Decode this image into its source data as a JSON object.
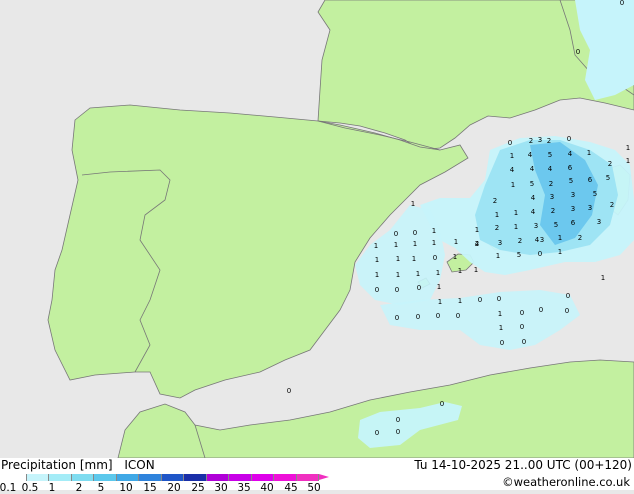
{
  "legend": {
    "title": "Precipitation [mm]",
    "model": "ICON",
    "datetime": "Tu 14-10-2025 21..00 UTC (00+120)",
    "credit": "©weatheronline.co.uk",
    "ticks": [
      "0.1",
      "0.5",
      "1",
      "2",
      "5",
      "10",
      "15",
      "20",
      "25",
      "30",
      "35",
      "40",
      "45",
      "50"
    ],
    "colors": [
      "#ffffff",
      "#c6f4fb",
      "#a4ecf7",
      "#7fdcf0",
      "#5cc8ec",
      "#3fa8e6",
      "#2f83dc",
      "#1f56c8",
      "#1a2fa8",
      "#b000d8",
      "#c800e8",
      "#de00ea",
      "#ee10d8",
      "#f030c0"
    ]
  },
  "map": {
    "colors": {
      "sea": "#e8e8e8",
      "land": "#c3f0a0",
      "border": "#777777",
      "light_precip": "#c6f4fb",
      "mid_precip": "#9ee4f4",
      "heavy_precip": "#6cc8ee"
    },
    "labels": [
      {
        "t": "0"
      },
      {
        "t": "0"
      },
      {
        "t": "3"
      },
      {
        "t": "0"
      },
      {
        "t": "2"
      },
      {
        "t": "2"
      },
      {
        "t": "0"
      },
      {
        "t": "1"
      },
      {
        "t": "4"
      },
      {
        "t": "5"
      },
      {
        "t": "4"
      },
      {
        "t": "1"
      },
      {
        "t": "1"
      },
      {
        "t": "4"
      },
      {
        "t": "4"
      },
      {
        "t": "4"
      },
      {
        "t": "6"
      },
      {
        "t": "2"
      },
      {
        "t": "1"
      },
      {
        "t": "1"
      },
      {
        "t": "5"
      },
      {
        "t": "2"
      },
      {
        "t": "5"
      },
      {
        "t": "6"
      },
      {
        "t": "5"
      },
      {
        "t": "2"
      },
      {
        "t": "4"
      },
      {
        "t": "3"
      },
      {
        "t": "3"
      },
      {
        "t": "5"
      },
      {
        "t": "1"
      },
      {
        "t": "1"
      },
      {
        "t": "4"
      },
      {
        "t": "2"
      },
      {
        "t": "3"
      },
      {
        "t": "3"
      },
      {
        "t": "2"
      },
      {
        "t": "1"
      },
      {
        "t": "2"
      },
      {
        "t": "1"
      },
      {
        "t": "3"
      },
      {
        "t": "5"
      },
      {
        "t": "6"
      },
      {
        "t": "3"
      },
      {
        "t": "1"
      },
      {
        "t": "0"
      },
      {
        "t": "0"
      },
      {
        "t": "1"
      },
      {
        "t": "2"
      },
      {
        "t": "3"
      },
      {
        "t": "2"
      },
      {
        "t": "4"
      },
      {
        "t": "1"
      },
      {
        "t": "1"
      },
      {
        "t": "1"
      },
      {
        "t": "1"
      },
      {
        "t": "1"
      },
      {
        "t": "4"
      },
      {
        "t": "3"
      },
      {
        "t": "1"
      },
      {
        "t": "2"
      },
      {
        "t": "1"
      },
      {
        "t": "1"
      },
      {
        "t": "1"
      },
      {
        "t": "0"
      },
      {
        "t": "1"
      },
      {
        "t": "1"
      },
      {
        "t": "5"
      },
      {
        "t": "0"
      },
      {
        "t": "1"
      },
      {
        "t": "1"
      },
      {
        "t": "1"
      },
      {
        "t": "1"
      },
      {
        "t": "1"
      },
      {
        "t": "1"
      },
      {
        "t": "1"
      },
      {
        "t": "1"
      },
      {
        "t": "0"
      },
      {
        "t": "0"
      },
      {
        "t": "0"
      },
      {
        "t": "0"
      },
      {
        "t": "1"
      },
      {
        "t": "1"
      },
      {
        "t": "1"
      },
      {
        "t": "0"
      },
      {
        "t": "0"
      },
      {
        "t": "0"
      },
      {
        "t": "0"
      },
      {
        "t": "0"
      },
      {
        "t": "0"
      },
      {
        "t": "0"
      },
      {
        "t": "1"
      },
      {
        "t": "0"
      },
      {
        "t": "1"
      },
      {
        "t": "0"
      },
      {
        "t": "0"
      },
      {
        "t": "0"
      },
      {
        "t": "0"
      },
      {
        "t": "0"
      },
      {
        "t": "0"
      },
      {
        "t": "0"
      },
      {
        "t": "0"
      },
      {
        "t": "0"
      },
      {
        "t": "0"
      }
    ]
  }
}
